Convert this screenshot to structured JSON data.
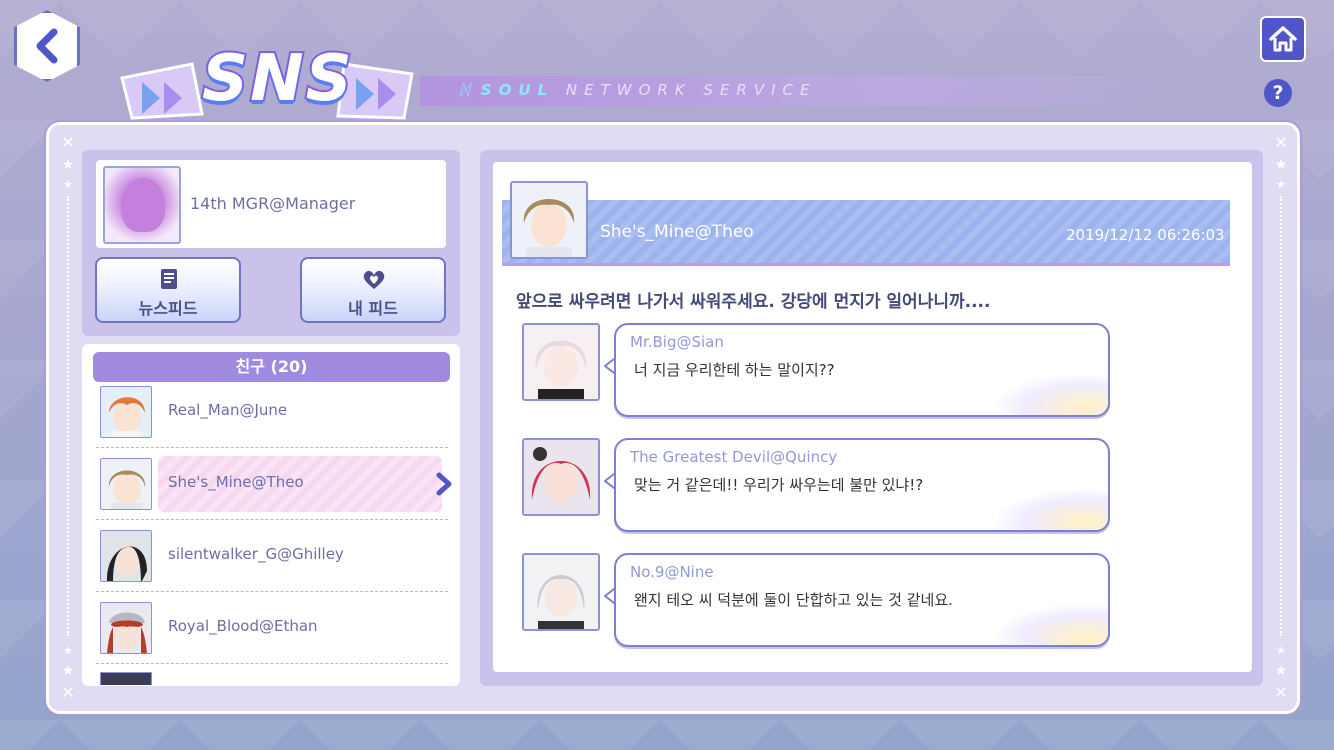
{
  "header": {
    "logo_text": "SNS",
    "subtitle_soul": "SOUL",
    "subtitle_rest": "NETWORK SERVICE",
    "back_icon": "chevron-left-icon",
    "home_icon": "home-icon",
    "help_label": "?"
  },
  "profile": {
    "name": "14th MGR@Manager",
    "newsfeed_label": "뉴스피드",
    "my_feed_label": "내 피드",
    "newsfeed_icon": "book-icon",
    "my_feed_icon": "heart-hands-icon"
  },
  "friends": {
    "header": "친구 (20)",
    "items": [
      {
        "name": "Real_Man@June"
      },
      {
        "name": "She's_Mine@Theo"
      },
      {
        "name": "silentwalker_G@Ghilley"
      },
      {
        "name": "Royal_Blood@Ethan"
      }
    ]
  },
  "post": {
    "author": "She's_Mine@Theo",
    "timestamp": "2019/12/12 06:26:03",
    "body": "앞으로 싸우려면 나가서 싸워주세요. 강당에 먼지가 일어나니까....",
    "comments": [
      {
        "name": "Mr.Big@Sian",
        "text": "너 지금 우리한테 하는 말이지??"
      },
      {
        "name": "The Greatest Devil@Quincy",
        "text": "맞는 거 같은데!! 우리가 싸우는데 불만 있냐!?"
      },
      {
        "name": "No.9@Nine",
        "text": "왠지 테오 씨 덕분에 둘이 단합하고 있는 것 같네요."
      }
    ]
  },
  "colors": {
    "accent": "#6e74c6",
    "friends_header": "#9f8ae0",
    "selected_row": "#fbe3f6"
  }
}
